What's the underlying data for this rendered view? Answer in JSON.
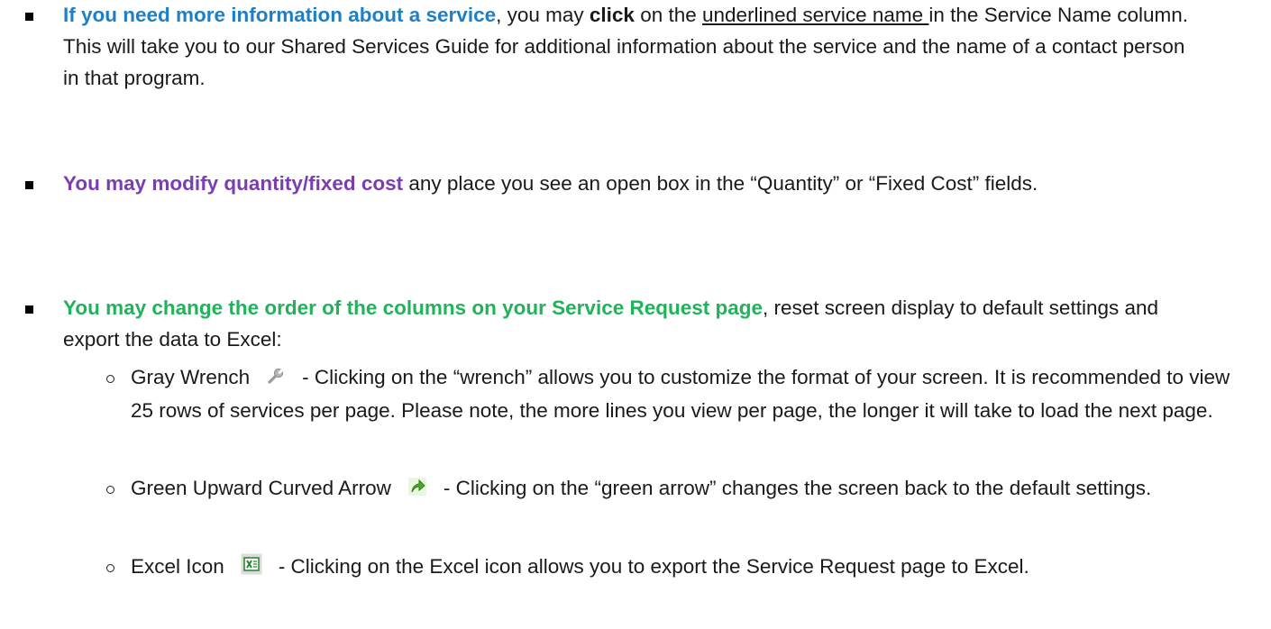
{
  "bullets": {
    "b1": {
      "lead": "If you need more information about a service",
      "t1": ", you may ",
      "click": "click",
      "t2": " on the ",
      "link": "underlined service name ",
      "t3": "in the Service Name column.  This will take you to our Shared Services Guide for additional information about the service and the name of a contact person in that program."
    },
    "b2": {
      "lead": "You may modify quantity/fixed cost",
      "rest": " any place you see an open box in the “Quantity” or “Fixed Cost” fields."
    },
    "b3": {
      "lead": "You may change the order of the columns on your Service Request page",
      "rest": ", reset screen display to default settings and export the data to Excel:"
    }
  },
  "subitems": [
    {
      "label": "Gray Wrench",
      "icon": "wrench-icon",
      "text": "- Clicking on the “wrench” allows you to customize the format of your screen.  It is recommended to view 25 rows of services per page.  Please note, the more lines you view per page, the longer it will take to load the next page."
    },
    {
      "label": "Green Upward Curved Arrow",
      "icon": "green-arrow-icon",
      "text": "- Clicking on the “green arrow” changes the screen back to the default settings."
    },
    {
      "label": "Excel Icon",
      "icon": "excel-icon",
      "text": "- Clicking on the Excel icon allows you to export the Service Request page to Excel."
    }
  ],
  "colors": {
    "blue": "#1f7fc4",
    "purple": "#7b3db0",
    "green": "#1fb35a"
  }
}
